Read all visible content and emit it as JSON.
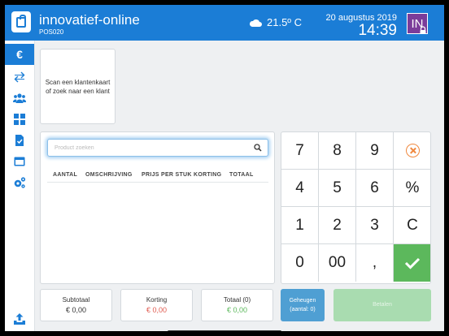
{
  "header": {
    "title": "innovatief-online",
    "subtitle": "POS020",
    "temperature": "21.5º C",
    "date": "20 augustus 2019",
    "time": "14:39",
    "user_initials": "IN",
    "icons": [
      "shopping-bag-icon",
      "cloud-icon",
      "lock-icon"
    ]
  },
  "sidebar": {
    "items": [
      {
        "name": "euro",
        "label": "€",
        "active": true
      },
      {
        "name": "transfer",
        "icon": "arrows-icon"
      },
      {
        "name": "customers",
        "icon": "users-icon"
      },
      {
        "name": "dashboard",
        "icon": "grid-icon"
      },
      {
        "name": "tasks",
        "icon": "checklist-icon"
      },
      {
        "name": "window",
        "icon": "window-icon"
      },
      {
        "name": "settings",
        "icon": "gears-icon"
      },
      {
        "name": "upload",
        "icon": "upload-icon"
      }
    ]
  },
  "customer": {
    "prompt": "Scan een klantenkaart of zoek naar een klant"
  },
  "products": {
    "search_placeholder": "Product zoeken",
    "columns": [
      "AANTAL",
      "OMSCHRIJVING",
      "PRIJS PER STUK",
      "KORTING",
      "TOTAAL"
    ],
    "rows": []
  },
  "keypad": {
    "keys": [
      "7",
      "8",
      "9",
      "clear",
      "4",
      "5",
      "6",
      "%",
      "1",
      "2",
      "3",
      "C",
      "0",
      "00",
      ",",
      "ok"
    ]
  },
  "totals": {
    "subtotal_label": "Subtotaal",
    "subtotal_value": "€ 0,00",
    "discount_label": "Korting",
    "discount_value": "€ 0,00",
    "total_label": "Totaal (0)",
    "total_value": "€ 0,00"
  },
  "actions": {
    "memory_label": "Geheugen",
    "memory_count": "(aantal: 0)",
    "pay_label": "Betalen"
  },
  "colors": {
    "primary": "#1b7dd6",
    "user_badge": "#7b3c9a",
    "discount": "#e05a4f",
    "total": "#5cb85c",
    "ok_key": "#5cb85c",
    "clear_key": "#f0883e",
    "memory": "#4f9fd3",
    "pay_disabled": "#a9dcb0"
  }
}
